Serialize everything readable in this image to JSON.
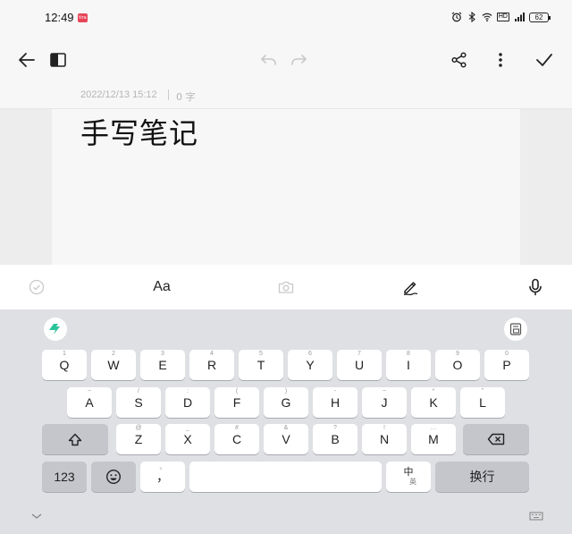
{
  "status_bar": {
    "time": "12:49",
    "app_badge": "tira",
    "hd_label": "HD",
    "signal_label": "5G",
    "battery_level": "62"
  },
  "toolbar": {
    "back_icon": "arrow-left-icon",
    "sidebar_icon": "split-view-icon",
    "undo_icon": "undo-icon",
    "redo_icon": "redo-icon",
    "share_icon": "share-icon",
    "more_icon": "more-vertical-icon",
    "done_icon": "check-icon"
  },
  "note": {
    "date": "2022/12/13 15:12",
    "char_count": "0 字",
    "title": "手写笔记"
  },
  "edit_bar": {
    "checklist_icon": "check-circle-icon",
    "text_style_label": "Aa",
    "camera_icon": "camera-icon",
    "pen_icon": "pen-icon",
    "mic_icon": "microphone-icon"
  },
  "keyboard": {
    "row1": [
      {
        "key": "Q",
        "sub": "1"
      },
      {
        "key": "W",
        "sub": "2"
      },
      {
        "key": "E",
        "sub": "3"
      },
      {
        "key": "R",
        "sub": "4"
      },
      {
        "key": "T",
        "sub": "5"
      },
      {
        "key": "Y",
        "sub": "6"
      },
      {
        "key": "U",
        "sub": "7"
      },
      {
        "key": "I",
        "sub": "8"
      },
      {
        "key": "O",
        "sub": "9"
      },
      {
        "key": "P",
        "sub": "0"
      }
    ],
    "row2": [
      {
        "key": "A",
        "sub": "~"
      },
      {
        "key": "S",
        "sub": "/"
      },
      {
        "key": "D",
        "sub": ":"
      },
      {
        "key": "F",
        "sub": "("
      },
      {
        "key": "G",
        "sub": ")"
      },
      {
        "key": "H",
        "sub": "-"
      },
      {
        "key": "J",
        "sub": "~"
      },
      {
        "key": "K",
        "sub": "*"
      },
      {
        "key": "L",
        "sub": "\""
      }
    ],
    "row3": [
      {
        "key": "Z",
        "sub": "@"
      },
      {
        "key": "X",
        "sub": "_"
      },
      {
        "key": "C",
        "sub": "#"
      },
      {
        "key": "V",
        "sub": "&"
      },
      {
        "key": "B",
        "sub": "?"
      },
      {
        "key": "N",
        "sub": "!"
      },
      {
        "key": "M",
        "sub": "…"
      }
    ],
    "numbers_label": "123",
    "comma_label": "，",
    "comma_sub": "。",
    "lang_main": "中",
    "lang_sub": "英",
    "enter_label": "换行"
  }
}
